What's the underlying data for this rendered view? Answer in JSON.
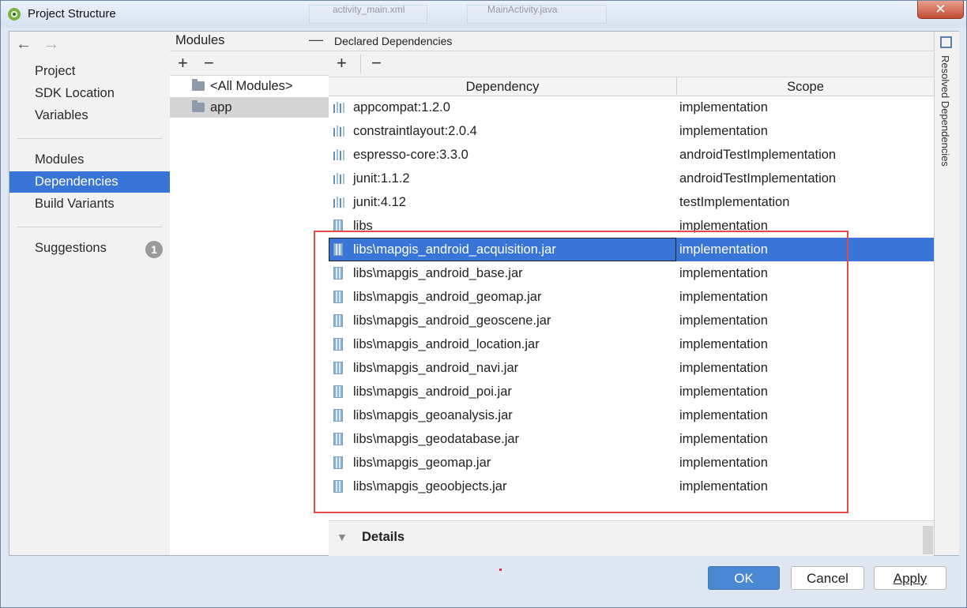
{
  "window": {
    "title": "Project Structure",
    "close_glyph": "✕"
  },
  "background_tabs": [
    "activity_main.xml",
    "MainActivity.java"
  ],
  "nav": {
    "back": "←",
    "forward": "→"
  },
  "sidebar": {
    "items": [
      "Project",
      "SDK Location",
      "Variables",
      "Modules",
      "Dependencies",
      "Build Variants",
      "Suggestions"
    ],
    "selected": "Dependencies",
    "suggestions_badge": "1"
  },
  "modules_panel": {
    "title": "Modules",
    "minimize_glyph": "—",
    "add_glyph": "+",
    "remove_glyph": "−",
    "items": [
      "<All Modules>",
      "app"
    ],
    "selected": "app"
  },
  "dependencies_panel": {
    "title": "Declared Dependencies",
    "add_glyph": "+",
    "remove_glyph": "−",
    "columns": [
      "Dependency",
      "Scope"
    ],
    "rows": [
      {
        "name": "appcompat:1.2.0",
        "scope": "implementation",
        "icon": "library-icon"
      },
      {
        "name": "constraintlayout:2.0.4",
        "scope": "implementation",
        "icon": "library-icon"
      },
      {
        "name": "espresso-core:3.3.0",
        "scope": "androidTestImplementation",
        "icon": "library-icon"
      },
      {
        "name": "junit:1.1.2",
        "scope": "androidTestImplementation",
        "icon": "library-icon"
      },
      {
        "name": "junit:4.12",
        "scope": "testImplementation",
        "icon": "library-icon"
      },
      {
        "name": "libs",
        "scope": "implementation",
        "icon": "jar-icon"
      },
      {
        "name": "libs\\mapgis_android_acquisition.jar",
        "scope": "implementation",
        "icon": "jar-icon"
      },
      {
        "name": "libs\\mapgis_android_base.jar",
        "scope": "implementation",
        "icon": "jar-icon"
      },
      {
        "name": "libs\\mapgis_android_geomap.jar",
        "scope": "implementation",
        "icon": "jar-icon"
      },
      {
        "name": "libs\\mapgis_android_geoscene.jar",
        "scope": "implementation",
        "icon": "jar-icon"
      },
      {
        "name": "libs\\mapgis_android_location.jar",
        "scope": "implementation",
        "icon": "jar-icon"
      },
      {
        "name": "libs\\mapgis_android_navi.jar",
        "scope": "implementation",
        "icon": "jar-icon"
      },
      {
        "name": "libs\\mapgis_android_poi.jar",
        "scope": "implementation",
        "icon": "jar-icon"
      },
      {
        "name": "libs\\mapgis_geoanalysis.jar",
        "scope": "implementation",
        "icon": "jar-icon"
      },
      {
        "name": "libs\\mapgis_geodatabase.jar",
        "scope": "implementation",
        "icon": "jar-icon"
      },
      {
        "name": "libs\\mapgis_geomap.jar",
        "scope": "implementation",
        "icon": "jar-icon"
      },
      {
        "name": "libs\\mapgis_geoobjects.jar",
        "scope": "implementation",
        "icon": "jar-icon"
      }
    ],
    "selected_row": "libs\\mapgis_android_acquisition.jar",
    "details": {
      "arrow_glyph": "▼",
      "label": "Details"
    }
  },
  "resolved_tab": {
    "label": "Resolved Dependencies"
  },
  "buttons": {
    "ok": "OK",
    "cancel": "Cancel",
    "apply": "Apply"
  },
  "colors": {
    "selection": "#3875d7",
    "annotation_box": "#e24a4a",
    "ok_button": "#4a88d1"
  }
}
